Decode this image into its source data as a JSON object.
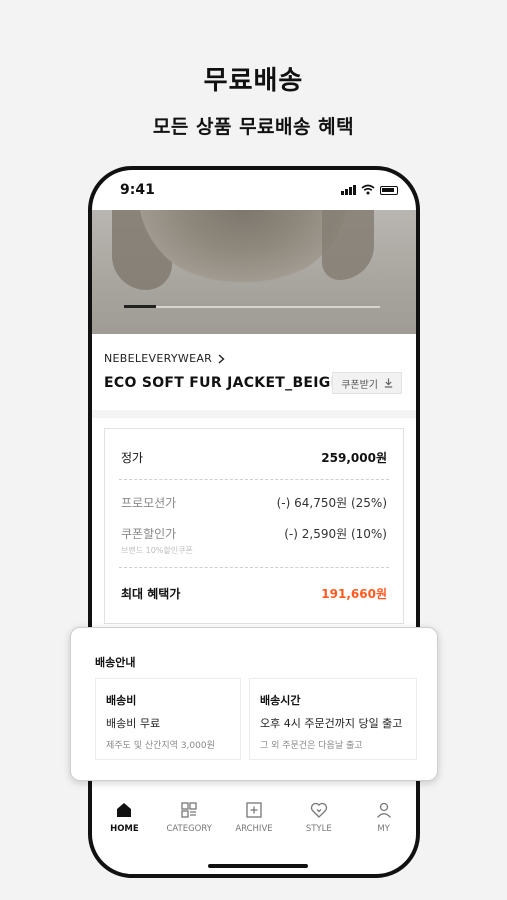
{
  "header": {
    "title": "무료배송",
    "subtitle": "모든 상품 무료배송 혜택"
  },
  "status_bar": {
    "time": "9:41"
  },
  "product": {
    "brand": "NEBELEVERYWEAR",
    "name": "ECO SOFT FUR JACKET_BEIGE",
    "coupon_button": "쿠폰받기",
    "image_slider_progress": 0.125
  },
  "pricing": {
    "regular_label": "정가",
    "regular_value": "259,000원",
    "promo_label": "프로모션가",
    "promo_value": "(-) 64,750원 (25%)",
    "coupon_label": "쿠폰할인가",
    "coupon_value": "(-) 2,590원 (10%)",
    "coupon_note": "브랜드 10%할인쿠폰",
    "max_label": "최대 혜택가",
    "max_value": "191,660원"
  },
  "shipping": {
    "title": "배송안내",
    "fee_heading": "배송비",
    "fee_main": "배송비 무료",
    "fee_sub": "제주도 및 산간지역 3,000원",
    "time_heading": "배송시간",
    "time_main": "오후 4시 주문건까지 당일 출고",
    "time_sub": "그 외 주문건은 다음날 출고"
  },
  "tabbar": {
    "home": "HOME",
    "category": "CATEGORY",
    "archive": "ARCHIVE",
    "style": "STYLE",
    "my": "MY"
  },
  "colors": {
    "accent": "#ff5a1f",
    "background": "#f3f3f3"
  }
}
